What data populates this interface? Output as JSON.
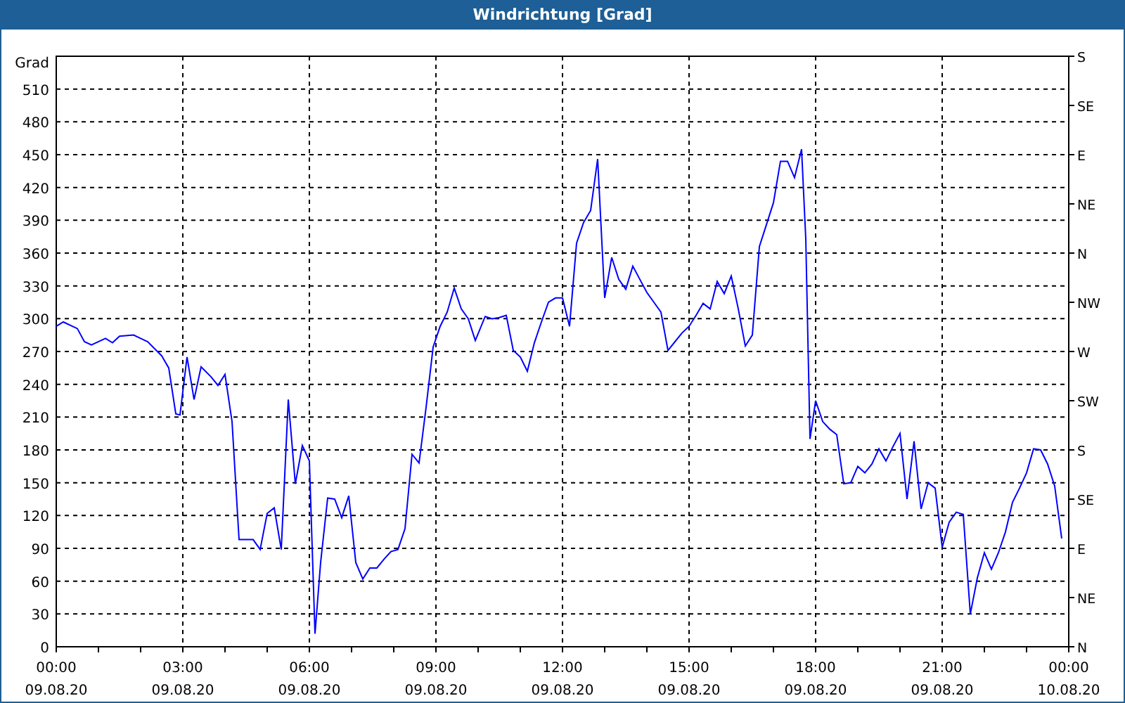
{
  "window": {
    "title": "Windrichtung [Grad]"
  },
  "chart": {
    "chart_data": {
      "type": "line",
      "ylabel": "Grad",
      "xlim": [
        0,
        1440
      ],
      "ylim": [
        0,
        540
      ],
      "grid": true,
      "xticks": [
        {
          "value": 0,
          "label": "00:00"
        },
        {
          "value": 180,
          "label": "03:00"
        },
        {
          "value": 360,
          "label": "06:00"
        },
        {
          "value": 540,
          "label": "09:00"
        },
        {
          "value": 720,
          "label": "12:00"
        },
        {
          "value": 900,
          "label": "15:00"
        },
        {
          "value": 1080,
          "label": "18:00"
        },
        {
          "value": 1260,
          "label": "21:00"
        }
      ],
      "yticks": [
        0,
        30,
        60,
        90,
        120,
        150,
        180,
        210,
        240,
        270,
        300,
        330,
        360,
        390,
        420,
        450,
        480,
        510
      ],
      "x": [
        0,
        10,
        30,
        40,
        50,
        70,
        80,
        90,
        110,
        120,
        130,
        150,
        160,
        170,
        176,
        186,
        196,
        206,
        220,
        230,
        240,
        250,
        260,
        270,
        280,
        290,
        300,
        310,
        320,
        330,
        340,
        350,
        360,
        368,
        376,
        386,
        396,
        406,
        416,
        426,
        436,
        446,
        456,
        466,
        476,
        486,
        496,
        506,
        516,
        526,
        536,
        546,
        556,
        566,
        576,
        586,
        596,
        610,
        620,
        630,
        640,
        650,
        660,
        670,
        680,
        690,
        700,
        710,
        720,
        730,
        740,
        750,
        760,
        770,
        780,
        790,
        800,
        810,
        820,
        830,
        840,
        850,
        860,
        870,
        880,
        890,
        900,
        910,
        920,
        930,
        940,
        950,
        960,
        970,
        980,
        990,
        1000,
        1010,
        1020,
        1030,
        1040,
        1050,
        1060,
        1066,
        1072,
        1080,
        1090,
        1100,
        1110,
        1120,
        1130,
        1140,
        1150,
        1160,
        1170,
        1180,
        1190,
        1200,
        1210,
        1220,
        1230,
        1240,
        1250,
        1260,
        1270,
        1280,
        1290,
        1300,
        1310,
        1320,
        1330,
        1340,
        1350,
        1360,
        1370,
        1380,
        1390,
        1400,
        1410,
        1420,
        1430
      ],
      "series": [
        {
          "color": "#0000ff",
          "values": [
            293,
            297,
            291,
            279,
            276,
            282,
            278,
            284,
            285,
            282,
            279,
            266,
            255,
            213,
            212,
            265,
            226,
            256,
            247,
            239,
            249,
            206,
            98,
            98,
            98,
            89,
            122,
            127,
            89,
            226,
            149,
            184,
            170,
            12,
            77,
            136,
            135,
            118,
            138,
            77,
            62,
            72,
            72,
            80,
            87,
            89,
            108,
            176,
            168,
            219,
            274,
            293,
            306,
            328,
            309,
            300,
            280,
            302,
            300,
            301,
            303,
            271,
            265,
            252,
            278,
            297,
            315,
            319,
            319,
            293,
            369,
            388,
            399,
            446,
            319,
            356,
            336,
            327,
            348,
            336,
            324,
            315,
            306,
            271,
            279,
            287,
            293,
            303,
            314,
            309,
            334,
            323,
            339,
            309,
            275,
            285,
            366,
            386,
            406,
            444,
            444,
            429,
            455,
            373,
            190,
            225,
            206,
            199,
            194,
            149,
            150,
            165,
            159,
            167,
            181,
            170,
            183,
            195,
            135,
            188,
            126,
            150,
            145,
            91,
            114,
            123,
            121,
            30,
            63,
            86,
            71,
            86,
            105,
            132,
            145,
            159,
            181,
            180,
            167,
            147,
            99
          ]
        }
      ]
    },
    "x_end_label": "00:00",
    "date_labels": [
      "09.08.20",
      "09.08.20",
      "09.08.20",
      "09.08.20",
      "09.08.20",
      "09.08.20",
      "09.08.20",
      "09.08.20",
      "10.08.20"
    ],
    "right_axis": {
      "labels": [
        "S",
        "SE",
        "E",
        "NE",
        "N",
        "NW",
        "W",
        "SW",
        "S",
        "SE",
        "E",
        "NE",
        "N"
      ]
    }
  }
}
